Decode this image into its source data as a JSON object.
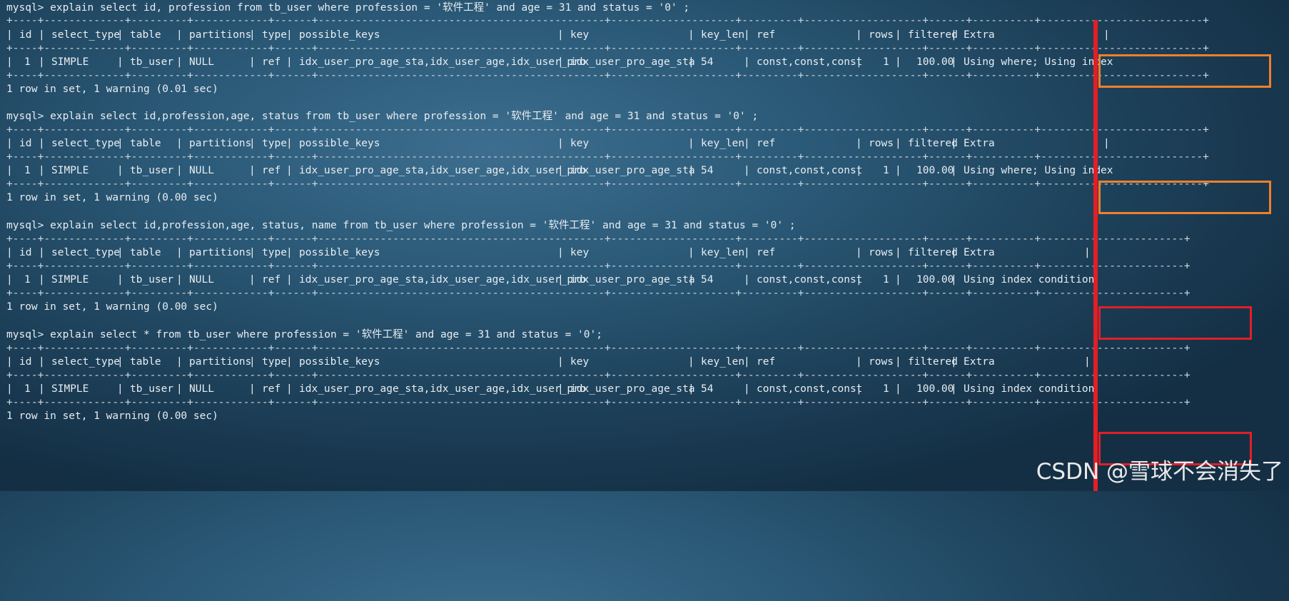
{
  "queries": [
    {
      "command": "mysql> explain select id, profession from tb_user where profession = '软件工程' and age = 31 and status = '0' ;",
      "separator": "+----+-------------+---------+------------+------+----------------------------------------------+--------------------+---------+-------------------+------+----------+--------------------------+",
      "headers": [
        "id",
        "select_type",
        "table",
        "partitions",
        "type",
        "possible_keys",
        "key",
        "key_len",
        "ref",
        "rows",
        "filtered",
        "Extra"
      ],
      "row": [
        "1",
        "SIMPLE",
        "tb_user",
        "NULL",
        "ref",
        "idx_user_pro_age_sta,idx_user_age,idx_user_pro",
        "idx_user_pro_age_sta",
        "54",
        "const,const,const",
        "1",
        "100.00",
        "Using where; Using index"
      ],
      "footer": "1 row in set, 1 warning (0.01 sec)"
    },
    {
      "command": "mysql> explain select id,profession,age, status from tb_user where profession = '软件工程' and age = 31 and status = '0' ;",
      "separator": "+----+-------------+---------+------------+------+----------------------------------------------+--------------------+---------+-------------------+------+----------+--------------------------+",
      "headers": [
        "id",
        "select_type",
        "table",
        "partitions",
        "type",
        "possible_keys",
        "key",
        "key_len",
        "ref",
        "rows",
        "filtered",
        "Extra"
      ],
      "row": [
        "1",
        "SIMPLE",
        "tb_user",
        "NULL",
        "ref",
        "idx_user_pro_age_sta,idx_user_age,idx_user_pro",
        "idx_user_pro_age_sta",
        "54",
        "const,const,const",
        "1",
        "100.00",
        "Using where; Using index"
      ],
      "footer": "1 row in set, 1 warning (0.00 sec)"
    },
    {
      "command": "mysql> explain select id,profession,age, status, name from tb_user where profession = '软件工程' and age = 31 and status = '0' ;",
      "separator": "+----+-------------+---------+------------+------+----------------------------------------------+--------------------+---------+-------------------+------+----------+-----------------------+",
      "headers": [
        "id",
        "select_type",
        "table",
        "partitions",
        "type",
        "possible_keys",
        "key",
        "key_len",
        "ref",
        "rows",
        "filtered",
        "Extra"
      ],
      "row": [
        "1",
        "SIMPLE",
        "tb_user",
        "NULL",
        "ref",
        "idx_user_pro_age_sta,idx_user_age,idx_user_pro",
        "idx_user_pro_age_sta",
        "54",
        "const,const,const",
        "1",
        "100.00",
        "Using index condition"
      ],
      "footer": "1 row in set, 1 warning (0.00 sec)"
    },
    {
      "command": "mysql> explain select * from tb_user where profession = '软件工程' and age = 31 and status = '0';",
      "separator": "+----+-------------+---------+------------+------+----------------------------------------------+--------------------+---------+-------------------+------+----------+-----------------------+",
      "headers": [
        "id",
        "select_type",
        "table",
        "partitions",
        "type",
        "possible_keys",
        "key",
        "key_len",
        "ref",
        "rows",
        "filtered",
        "Extra"
      ],
      "row": [
        "1",
        "SIMPLE",
        "tb_user",
        "NULL",
        "ref",
        "idx_user_pro_age_sta,idx_user_age,idx_user_pro",
        "idx_user_pro_age_sta",
        "54",
        "const,const,const",
        "1",
        "100.00",
        "Using index condition"
      ],
      "footer": "1 row in set, 1 warning (0.00 sec)"
    }
  ],
  "highlight_colors": {
    "orange": "#f0802a",
    "red": "#e21f26"
  },
  "watermark": "CSDN @雪球不会消失了"
}
